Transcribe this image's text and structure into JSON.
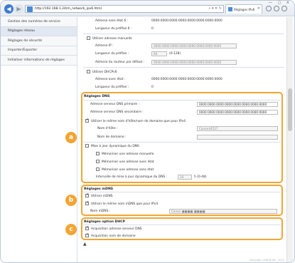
{
  "browser": {
    "url": "http://192.168.1.24/m_network_ipv6.html",
    "tab_title": "Réglages IPv6",
    "window_controls": "— ▢ ✕"
  },
  "sidebar": {
    "items": [
      {
        "label": "Gestion des numéros de service",
        "active": false
      },
      {
        "label": "Réglages réseau",
        "active": true
      },
      {
        "label": "Réglages de sécurité",
        "active": false
      },
      {
        "label": "Importer/Exporter",
        "active": false
      },
      {
        "label": "Initialiser informations de réglages",
        "active": false
      }
    ]
  },
  "ipv6_top": {
    "stateless_address": {
      "label": "Adresse sans état 6 :",
      "value": "0000:0000:0000:0000:0000:0000:0000:0000"
    },
    "prefix_length": {
      "label": "Longueur du préfixe 6 :",
      "value": "0"
    },
    "manual_address": {
      "label": "Utiliser adresse manuelle",
      "checked": false
    },
    "ip_address": {
      "label": "Adresse IP :",
      "value": "0000:0000:0000:0000:0000:0000:0000:0000"
    },
    "manual_prefix": {
      "label": "Longueur du préfixe :",
      "value": "64",
      "range": "(0-128)"
    },
    "default_router": {
      "label": "Adresse du routeur par défaut :",
      "value": "0000:0000:0000:0000:0000:0000:0000:0000"
    },
    "dhcpv6": {
      "label": "Utiliser DHCPv6",
      "checked": false
    },
    "stateful_address": {
      "label": "Adresse avec état :",
      "value": "0000:0000:0000:0000:0000:0000:0000:0000"
    },
    "stateful_prefix": {
      "label": "Longueur du préfixe :",
      "value": "0"
    }
  },
  "dns": {
    "title": "Réglages DNS",
    "primary": {
      "label": "Adresse serveur DNS primaire :",
      "value": "0000:0000:0000:0000:0000:0000:0000:0000"
    },
    "secondary": {
      "label": "Adresse serveur DNS secondaire :",
      "value": "0000:0000:0000:0000:0000:0000:0000:0000"
    },
    "same_host": {
      "label": "Utiliser le même nom d'hôte/nom de domaine que pour IPv4",
      "checked": true
    },
    "host_name": {
      "label": "Nom d'hôte :",
      "value": "Canon44527"
    },
    "domain_name": {
      "label": "Nom de domaine :",
      "value": ""
    },
    "dynamic_update": {
      "label": "Mise à jour dynamique du DNS",
      "checked": false
    },
    "register_manual": {
      "label": "Mémoriser une adresse manuelle",
      "checked": false
    },
    "register_stateful": {
      "label": "Mémoriser une adresse avec état",
      "checked": false
    },
    "register_stateless": {
      "label": "Mémoriser une adresse sans état",
      "checked": false
    },
    "interval": {
      "label": "Intervalle de mise à jour dynamique du DNS :",
      "value": "24",
      "unit": "h (0-48)"
    }
  },
  "mdns": {
    "title": "Réglages mDNS",
    "use_mdns": {
      "label": "Utiliser mDNS",
      "checked": true
    },
    "same_mdns": {
      "label": "Utiliser le même nom mDNS que pour IPv4",
      "checked": true
    },
    "mdns_name": {
      "label": "Nom mDNS :",
      "value": "Canon ■■■■ ■■■■"
    }
  },
  "dhcp": {
    "title": "Réglages option DHCP",
    "acquire_dns": {
      "label": "Acquisition adresse serveur DNS",
      "checked": true
    },
    "acquire_domain": {
      "label": "Acquisition nom de domaine",
      "checked": true
    }
  },
  "badges": {
    "a": "a",
    "b": "b",
    "c": "c"
  },
  "to_top": "▲",
  "copyright": "Copyright CANON INC. 2015",
  "colors": {
    "accent": "#f2a533",
    "browser_blue": "#3d7bd1"
  }
}
